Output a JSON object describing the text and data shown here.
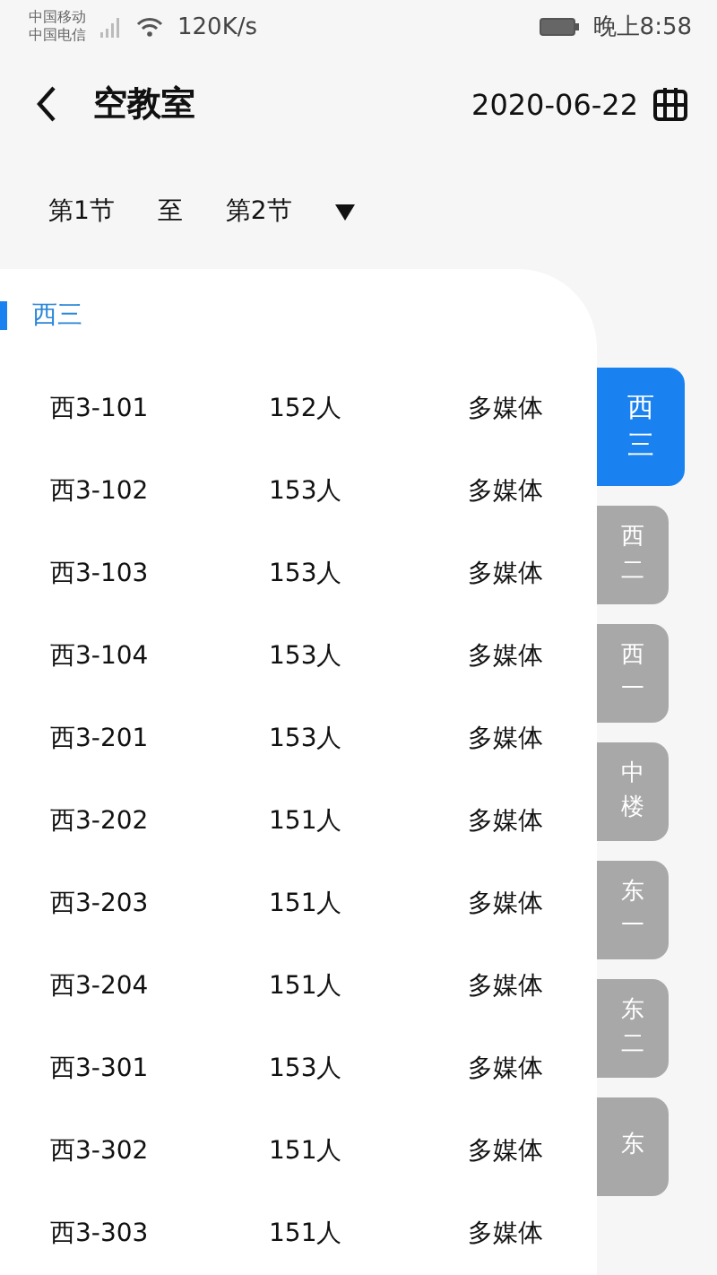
{
  "status_bar": {
    "carriers": [
      "中国移动",
      "中国电信"
    ],
    "speed": "120K/s",
    "time": "晚上8:58"
  },
  "header": {
    "title": "空教室",
    "date": "2020-06-22"
  },
  "period": {
    "from": "第1节",
    "separator": "至",
    "to": "第2节"
  },
  "section": "西三",
  "rooms": [
    {
      "name": "西3-101",
      "capacity": "152人",
      "type": "多媒体"
    },
    {
      "name": "西3-102",
      "capacity": "153人",
      "type": "多媒体"
    },
    {
      "name": "西3-103",
      "capacity": "153人",
      "type": "多媒体"
    },
    {
      "name": "西3-104",
      "capacity": "153人",
      "type": "多媒体"
    },
    {
      "name": "西3-201",
      "capacity": "153人",
      "type": "多媒体"
    },
    {
      "name": "西3-202",
      "capacity": "151人",
      "type": "多媒体"
    },
    {
      "name": "西3-203",
      "capacity": "151人",
      "type": "多媒体"
    },
    {
      "name": "西3-204",
      "capacity": "151人",
      "type": "多媒体"
    },
    {
      "name": "西3-301",
      "capacity": "153人",
      "type": "多媒体"
    },
    {
      "name": "西3-302",
      "capacity": "151人",
      "type": "多媒体"
    },
    {
      "name": "西3-303",
      "capacity": "151人",
      "type": "多媒体"
    }
  ],
  "buildings": [
    {
      "label": "西三",
      "selected": true
    },
    {
      "label": "西二",
      "selected": false
    },
    {
      "label": "西一",
      "selected": false
    },
    {
      "label": "中楼",
      "selected": false
    },
    {
      "label": "东一",
      "selected": false
    },
    {
      "label": "东二",
      "selected": false
    },
    {
      "label": "东",
      "selected": false
    }
  ]
}
